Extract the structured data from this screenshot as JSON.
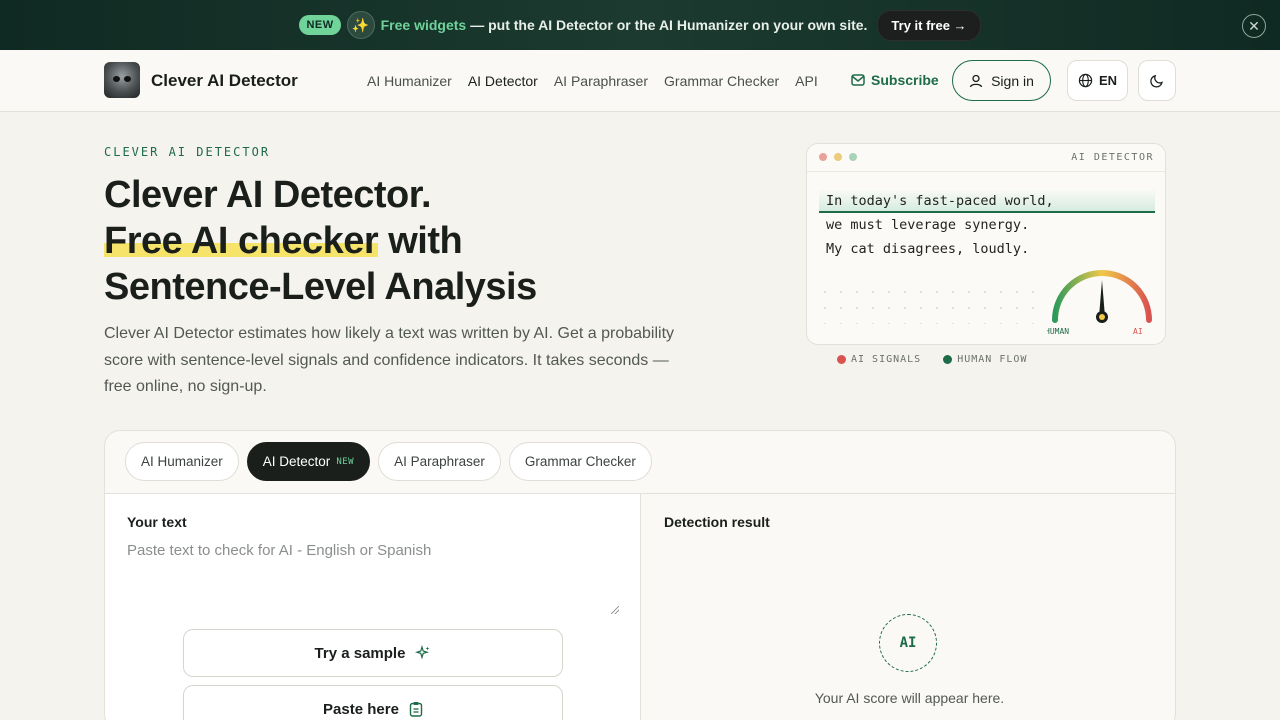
{
  "announcement": {
    "badge": "NEW",
    "icon": "sparkles-icon",
    "highlight": "Free widgets",
    "message": "— put the AI Detector or the AI Humanizer on your own site.",
    "cta": "Try it free →",
    "close_icon": "close-icon"
  },
  "nav": {
    "brand": "Clever AI Detector",
    "links": [
      "AI Humanizer",
      "AI Detector",
      "AI Paraphraser",
      "Grammar Checker",
      "API"
    ],
    "active_link": "AI Detector",
    "subscribe": "Subscribe",
    "sign_in": "Sign in",
    "language": "EN"
  },
  "hero": {
    "eyebrow": "CLEVER AI DETECTOR",
    "title_line1": "Clever AI Detector.",
    "title_highlight": "Free AI checker",
    "title_line2_rest": " with",
    "title_line3": "Sentence-Level Analysis",
    "subtitle": "Clever AI Detector estimates how likely a text was written by AI. Get a probability score with sentence-level signals and confidence indicators. It takes seconds — free online, no sign-up."
  },
  "demo_card": {
    "header": "AI DETECTOR",
    "lines": [
      "In today's fast-paced world,",
      "we must leverage synergy.",
      "My cat disagrees, loudly."
    ],
    "gauge_left": "HUMAN",
    "gauge_right": "AI",
    "gauge_level": 0.5,
    "legend": [
      "AI SIGNALS",
      "HUMAN FLOW"
    ],
    "colors": {
      "ai": "#d9534f",
      "human": "#1e6b48",
      "dot1": "#e8a29a",
      "dot2": "#eccb7b",
      "dot3": "#a9d3b8"
    }
  },
  "tool": {
    "tabs": [
      "AI Humanizer",
      "AI Detector",
      "AI Paraphraser",
      "Grammar Checker"
    ],
    "active_tab_badge": "NEW",
    "input_label": "Your text",
    "input_placeholder": "Paste text to check for AI - English or Spanish",
    "input_value": "",
    "sample_button": "Try a sample",
    "paste_button": "Paste here",
    "result_label": "Detection result",
    "result_badge": "AI",
    "result_hint": "Your AI score will appear here."
  }
}
